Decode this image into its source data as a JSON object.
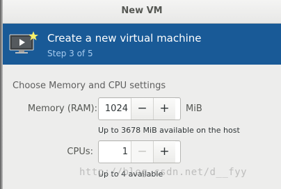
{
  "dialog": {
    "title": "New VM"
  },
  "banner": {
    "title": "Create a new virtual machine",
    "step": "Step 3 of 5",
    "icon": "vm-monitor-icon",
    "background": "#195a97"
  },
  "settings": {
    "section_label": "Choose Memory and CPU settings",
    "memory": {
      "label": "Memory (RAM):",
      "value": "1024",
      "decrement": "−",
      "increment": "+",
      "unit": "MiB",
      "hint": "Up to 3678 MiB available on the host"
    },
    "cpus": {
      "label": "CPUs:",
      "value": "1",
      "decrement": "−",
      "increment": "+",
      "hint": "Up to 4 available"
    }
  },
  "watermark": "http://blog.csdn.net/d__fyy"
}
